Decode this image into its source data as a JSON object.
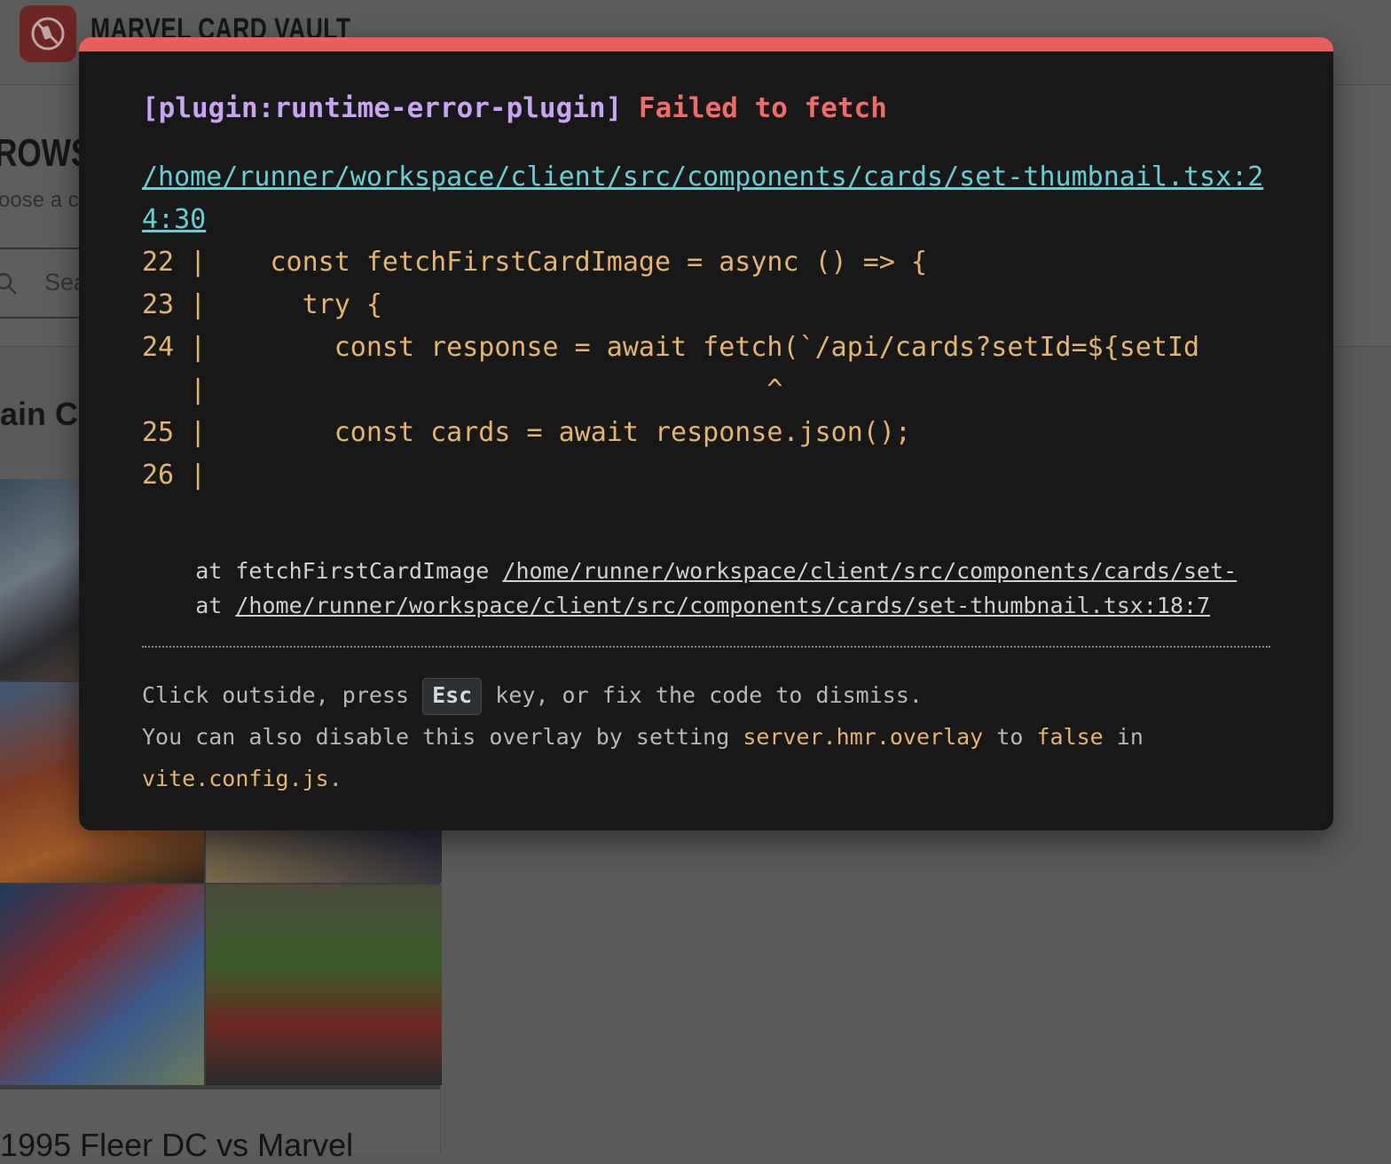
{
  "app": {
    "title": "MARVEL CARD VAULT",
    "browse_title": "ROWSE",
    "browse_subtitle": "oose a c",
    "search_placeholder": "Sea",
    "section_title": "ain C",
    "card_name": "1995 Fleer DC vs Marvel"
  },
  "overlay": {
    "plugin": "[plugin:runtime-error-plugin]",
    "message": "Failed to fetch",
    "file": "/home/runner/workspace/client/src/components/cards/set-thumbnail.tsx:24:30",
    "frame": [
      "22 |    const fetchFirstCardImage = async () => {",
      "23 |      try {",
      "24 |        const response = await fetch(`/api/cards?setId=${setId",
      "   |                                   ^",
      "25 |        const cards = await response.json();",
      "26 |"
    ],
    "stack": [
      {
        "prefix": "    at fetchFirstCardImage ",
        "link": "/home/runner/workspace/client/src/components/cards/set-"
      },
      {
        "prefix": "    at ",
        "link": "/home/runner/workspace/client/src/components/cards/set-thumbnail.tsx:18:7"
      }
    ],
    "tip": {
      "line1_before": "Click outside, press ",
      "key": "Esc",
      "line1_after": " key, or fix the code to dismiss.",
      "line2_before": "You can also disable this overlay by setting ",
      "code1": "server.hmr.overlay",
      "mid": " to ",
      "code2": "false",
      "in": " in",
      "code3": "vite.config.js",
      "end": "."
    }
  }
}
